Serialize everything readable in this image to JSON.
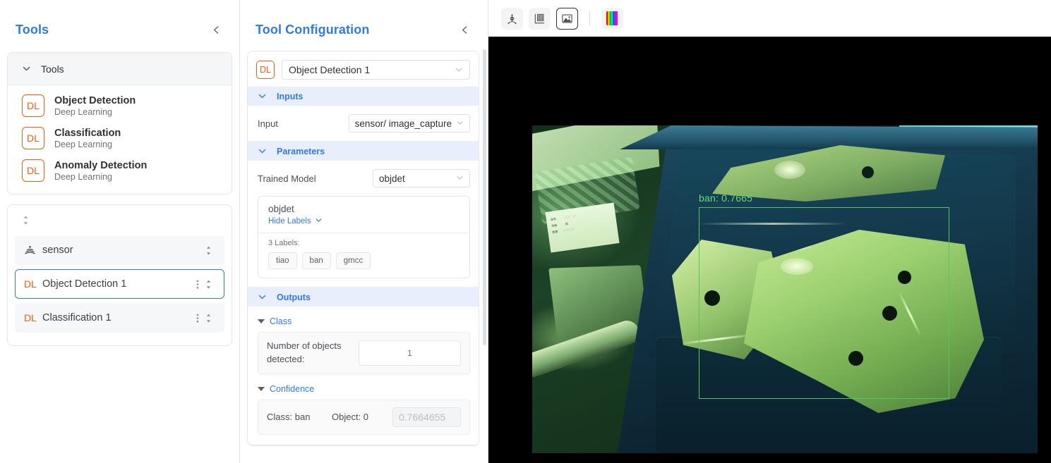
{
  "tools_panel": {
    "title": "Tools",
    "collapse_icon": "chevron-left-icon",
    "group": {
      "label": "Tools",
      "chevron": "chevron-down-icon"
    },
    "items": [
      {
        "badge": "DL",
        "name": "Object Detection",
        "subtitle": "Deep Learning"
      },
      {
        "badge": "DL",
        "name": "Classification",
        "subtitle": "Deep Learning"
      },
      {
        "badge": "DL",
        "name": "Anomaly Detection",
        "subtitle": "Deep Learning"
      }
    ],
    "pipeline": [
      {
        "icon": "sensor-icon",
        "badge": "",
        "label": "sensor",
        "selected": false,
        "has_menu": false
      },
      {
        "icon": "",
        "badge": "DL",
        "label": "Object Detection 1",
        "selected": true,
        "has_menu": true
      },
      {
        "icon": "",
        "badge": "DL",
        "label": "Classification 1",
        "selected": false,
        "has_menu": true
      }
    ]
  },
  "config_panel": {
    "title": "Tool Configuration",
    "collapse_icon": "chevron-left-icon",
    "tool_badge": "DL",
    "tool_select_value": "Object Detection 1",
    "sections": {
      "inputs": {
        "label": "Inputs",
        "input_label": "Input",
        "input_value": "sensor/ image_capture"
      },
      "parameters": {
        "label": "Parameters",
        "trained_model_label": "Trained Model",
        "trained_model_value": "objdet",
        "model_name": "objdet",
        "hide_labels": "Hide Labels",
        "labels_count": "3 Labels:",
        "labels": [
          "tiao",
          "ban",
          "gmcc"
        ]
      },
      "outputs": {
        "label": "Outputs",
        "class_group": "Class",
        "objects_detected_label": "Number of objects detected:",
        "objects_detected_value": "1",
        "confidence_group": "Confidence",
        "confidence_class": "Class: ban",
        "confidence_object": "Object: 0",
        "confidence_value": "0.7664655"
      }
    }
  },
  "viewer": {
    "toolbar": [
      {
        "name": "point-cloud-icon",
        "active": false
      },
      {
        "name": "depth-map-icon",
        "active": false
      },
      {
        "name": "image-icon",
        "active": true
      },
      {
        "name": "colormap-icon",
        "active": false
      }
    ],
    "detection": {
      "label": "ban: 0.7665",
      "box_color": "#5cc45c",
      "text_color": "#6ddc6d"
    }
  },
  "colors": {
    "accent": "#2f7ae5",
    "badge": "#e8610e",
    "section_bg": "#e8eefb",
    "detection_green": "#5cc45c"
  }
}
